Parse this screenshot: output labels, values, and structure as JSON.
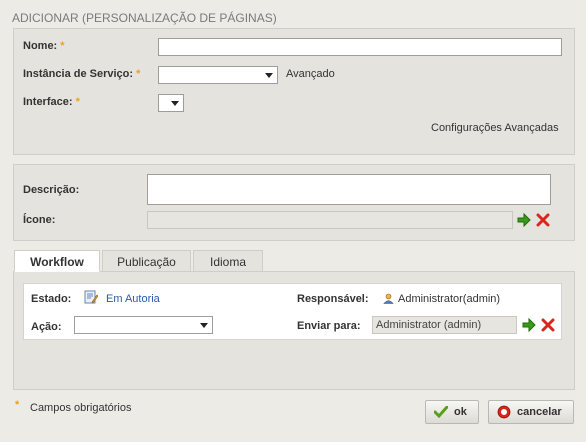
{
  "page": {
    "title": "ADICIONAR (PERSONALIZAÇÃO DE PÁGINAS)"
  },
  "form": {
    "nome_label": "Nome:",
    "instancia_label": "Instância de Serviço:",
    "avancado_label": "Avançado",
    "interface_label": "Interface:",
    "config_avancadas_link": "Configurações Avançadas",
    "required_mark": "*"
  },
  "details": {
    "descricao_label": "Descrição:",
    "icone_label": "Ícone:"
  },
  "tabs": [
    {
      "label": "Workflow",
      "active": true
    },
    {
      "label": "Publicação",
      "active": false
    },
    {
      "label": "Idioma",
      "active": false
    }
  ],
  "workflow": {
    "estado_label": "Estado:",
    "estado_value": "Em Autoria",
    "responsavel_label": "Responsável:",
    "responsavel_value": "Administrator(admin)",
    "acao_label": "Ação:",
    "enviar_label": "Enviar para:",
    "enviar_value": "Administrator (admin)"
  },
  "footer": {
    "required_note": "Campos obrigatórios",
    "ok_label": "ok",
    "cancel_label": "cancelar"
  },
  "colors": {
    "required": "#f0a020",
    "link": "#2a5aa0",
    "go_arrow": "#3a9a1a",
    "remove_x": "#d8261c"
  }
}
